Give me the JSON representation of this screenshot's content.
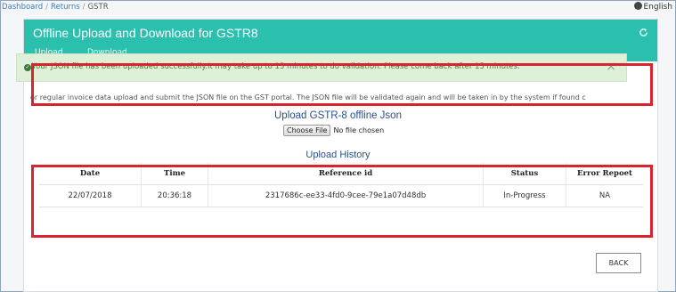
{
  "breadcrumb": {
    "items": [
      "Dashboard",
      "Returns",
      "GSTR"
    ]
  },
  "language": {
    "label": "English"
  },
  "header": {
    "title": "Offline Upload and Download for GSTR8",
    "tabs": [
      {
        "label": "Upload"
      },
      {
        "label": "Download"
      }
    ],
    "accent_color": "#2bbfad"
  },
  "alert": {
    "message": "Your JSON file has been uploaded successfully.It may take up to 15 minutes to do validation. Please come back after 15 minutes.",
    "close_symbol": "×"
  },
  "instruction": "or regular invoice data upload and submit the JSON file on the GST portal. The JSON file will be validated again and will be taken in by the system if found c",
  "upload": {
    "title": "Upload GSTR-8 offline Json",
    "choose_label": "Choose File",
    "no_file_text": "No file chosen"
  },
  "history": {
    "title": "Upload History",
    "columns": [
      "Date",
      "Time",
      "Reference id",
      "Status",
      "Error Repoet"
    ],
    "rows": [
      [
        "22/07/2018",
        "20:36:18",
        "2317686c-ee33-4fd0-9cee-79e1a07d48db",
        "In-Progress",
        "NA"
      ]
    ]
  },
  "back_label": "BACK",
  "highlight_color": "#d9232d"
}
